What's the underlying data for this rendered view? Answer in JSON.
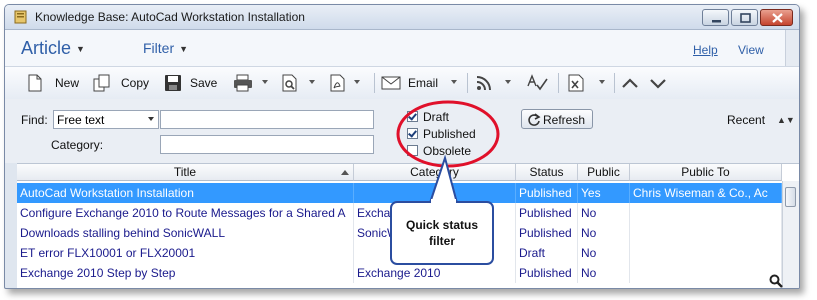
{
  "window": {
    "title": "Knowledge Base: AutoCad Workstation Installation"
  },
  "menu": {
    "article": "Article",
    "filter": "Filter",
    "help": "Help",
    "view": "View"
  },
  "toolbar": {
    "new": "New",
    "copy": "Copy",
    "save": "Save",
    "email": "Email"
  },
  "filter": {
    "find_label": "Find:",
    "find_mode": "Free text",
    "find_value": "",
    "category_label": "Category:",
    "category_value": "",
    "status": [
      {
        "label": "Draft",
        "checked": true
      },
      {
        "label": "Published",
        "checked": true
      },
      {
        "label": "Obsolete",
        "checked": false
      }
    ],
    "refresh": "Refresh",
    "recent": "Recent"
  },
  "grid": {
    "columns": [
      "Title",
      "Category",
      "Status",
      "Public",
      "Public To"
    ],
    "rows": [
      {
        "title": "AutoCad Workstation Installation",
        "category": "",
        "status": "Published",
        "public": "Yes",
        "public_to": "Chris Wiseman & Co., Ac",
        "selected": true
      },
      {
        "title": "Configure Exchange 2010 to Route Messages for a Shared A",
        "category": "Exchange 2010",
        "status": "Published",
        "public": "No",
        "public_to": "",
        "selected": false
      },
      {
        "title": "Downloads stalling behind SonicWALL",
        "category": "SonicWALL",
        "status": "Published",
        "public": "No",
        "public_to": "",
        "selected": false
      },
      {
        "title": "ET error FLX10001 or FLX20001",
        "category": "",
        "status": "Draft",
        "public": "No",
        "public_to": "",
        "selected": false
      },
      {
        "title": "Exchange 2010 Step by Step",
        "category": "Exchange 2010",
        "status": "Published",
        "public": "No",
        "public_to": "",
        "selected": false
      }
    ]
  },
  "callout": {
    "text": "Quick status filter"
  },
  "colors": {
    "accent": "#2f5fa8",
    "selection": "#3399ff",
    "highlight_ring": "#e0102a",
    "callout_border": "#2b4da0"
  }
}
